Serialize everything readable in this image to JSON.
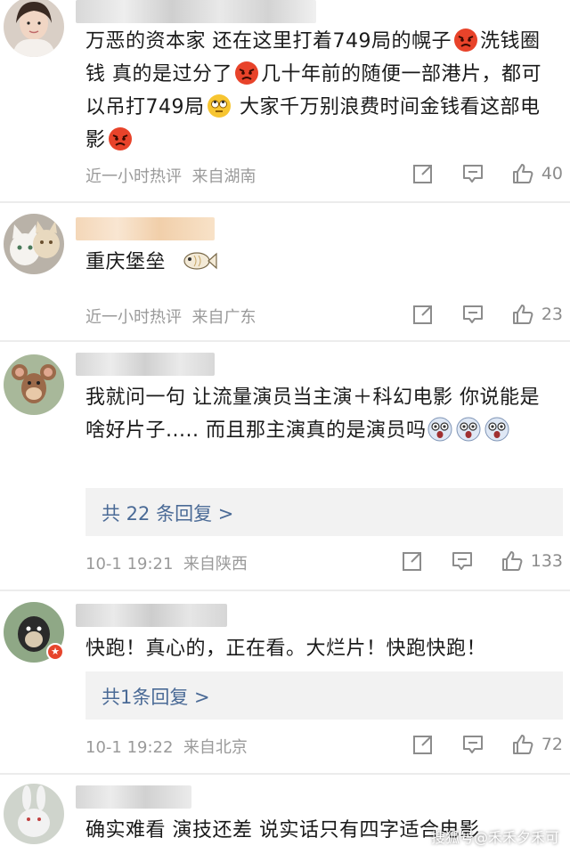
{
  "comments": [
    {
      "text_parts": [
        "万恶的资本家 还在这里打着749局的幌子",
        "洗钱圈钱 真的是过分了",
        "几十年前的随便一部港片，都可以吊打749局",
        " 大家千万别浪费时间金钱看这部电影"
      ],
      "time": "近一小时热评",
      "location": "来自湖南",
      "likes": "40"
    },
    {
      "text": "重庆堡垒",
      "time": "近一小时热评",
      "location": "来自广东",
      "likes": "23"
    },
    {
      "text": "我就问一句 让流量演员当主演＋科幻电影 你说能是啥好片子..... 而且那主演真的是演员吗",
      "reply_label": "共 22 条回复 >",
      "time": "10-1 19:21",
      "location": "来自陕西",
      "likes": "133"
    },
    {
      "text": "快跑！真心的，正在看。大烂片！快跑快跑！",
      "reply_label": "共1条回复 >",
      "time": "10-1 19:22",
      "location": "来自北京",
      "likes": "72"
    },
    {
      "text": "确实难看 演技还差 说实话只有四字适合电影"
    }
  ],
  "watermark": "搜狐号@禾禾夕禾可",
  "colors": {
    "reply_link": "#4a6a96",
    "meta_gray": "#9a9a9a",
    "reply_bg": "#f2f2f2"
  },
  "icons": {
    "share": "share-icon",
    "comment": "comment-icon",
    "like": "thumbs-up-icon",
    "angry_emoji": "angry-face-emoji",
    "eyeroll_emoji": "eye-roll-emoji",
    "shocked_emoji": "shocked-face-emoji",
    "fish_emoji": "fish-emoji"
  }
}
